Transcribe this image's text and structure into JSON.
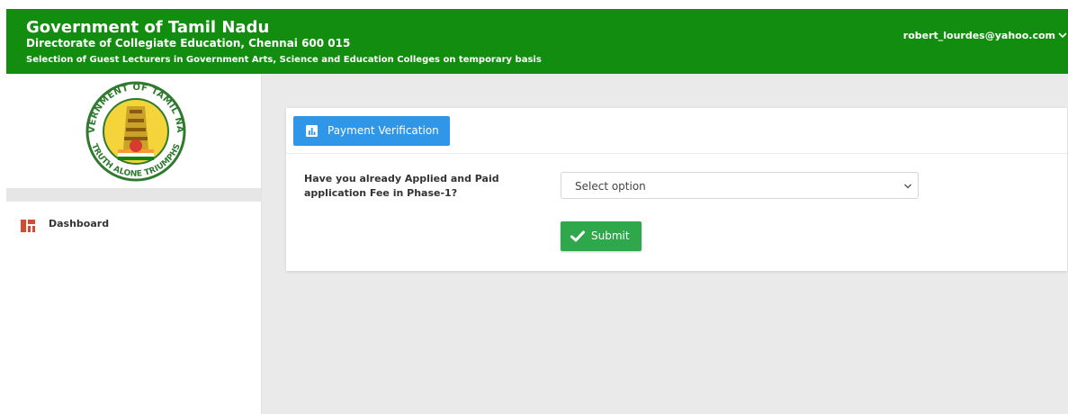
{
  "header": {
    "title": "Government of Tamil Nadu",
    "subtitle": "Directorate of Collegiate Education, Chennai 600 015",
    "tagline": "Selection of Guest Lecturers in Government Arts, Science and Education Colleges on temporary basis",
    "user_email": "robert_lourdes@yahoo.com"
  },
  "sidebar": {
    "emblem": {
      "top_text": "GOVERNMENT OF TAMIL NADU",
      "bottom_text": "TRUTH ALONE TRIUMPHS"
    },
    "items": [
      {
        "label": "Dashboard",
        "icon": "dashboard-icon"
      }
    ]
  },
  "main": {
    "tab_label": "Payment Verification",
    "question": "Have you already Applied and Paid application Fee in Phase-1?",
    "select": {
      "selected": "Select option"
    },
    "submit_label": "Submit"
  },
  "colors": {
    "header_bg": "#138d0f",
    "tab_bg": "#2f96e8",
    "submit_bg": "#2ea84b",
    "dashboard_icon": "#d64a2f",
    "content_bg": "#eaeaea"
  }
}
